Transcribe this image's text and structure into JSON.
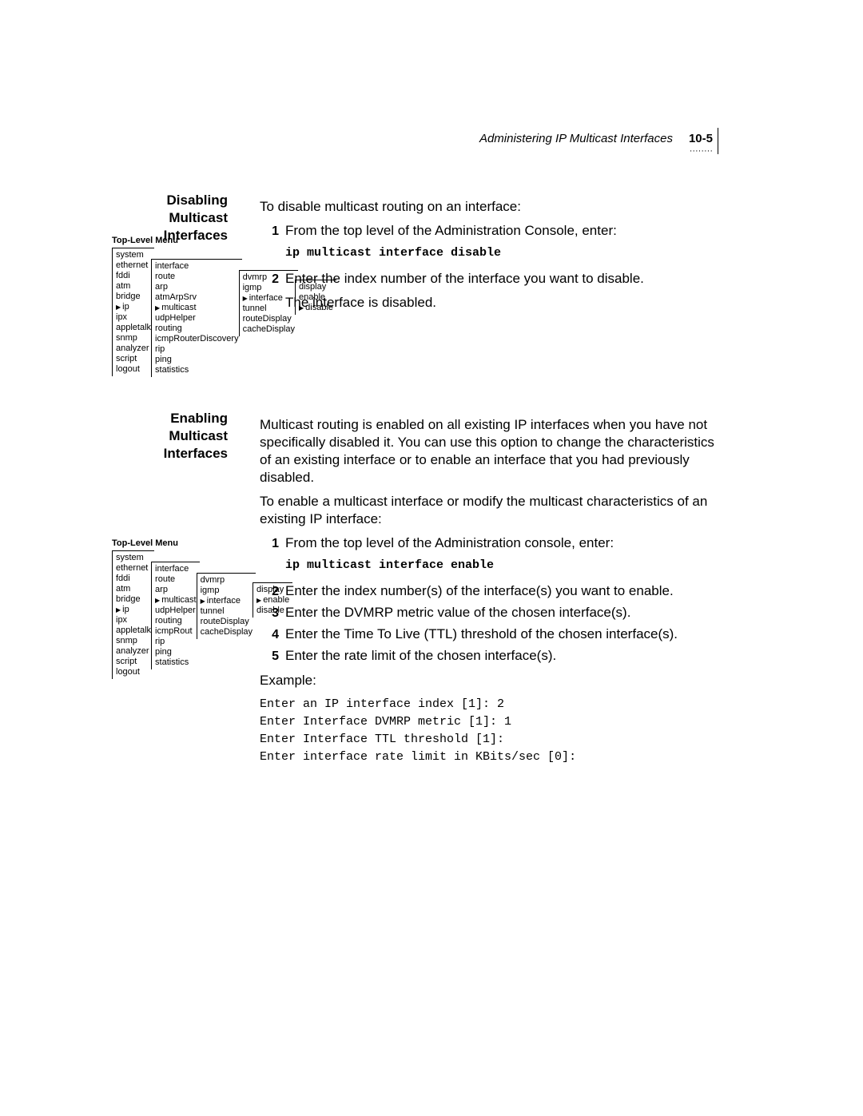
{
  "header": {
    "running": "Administering IP Multicast Interfaces",
    "page": "10-5",
    "dots": "········"
  },
  "disable": {
    "heading": "Disabling Multicast Interfaces",
    "intro": "To disable multicast routing on an interface:",
    "step1_lead": "From the top level of the Administration Console, enter:",
    "step1_code": "ip multicast interface disable",
    "step2": "Enter the index number of the interface you want to disable.",
    "result": "The interface is disabled."
  },
  "enable": {
    "heading": "Enabling Multicast Interfaces",
    "intro": "Multicast routing is enabled on all existing IP interfaces when you have not specifically disabled it. You can use this option to change the characteristics of an existing interface or to enable an interface that you had previously disabled.",
    "lead2": "To enable a multicast interface or modify the multicast characteristics of an existing IP interface:",
    "step1_lead": "From the top level of the Administration console, enter:",
    "step1_code": "ip multicast interface enable",
    "step2": "Enter the index number(s) of the interface(s) you want to enable.",
    "step3": "Enter the DVMRP metric value of the chosen interface(s).",
    "step4": "Enter the Time To Live (TTL) threshold of the chosen interface(s).",
    "step5": "Enter the rate limit of the chosen interface(s).",
    "example_label": "Example:",
    "example_code": "Enter an IP interface index [1]: 2\nEnter Interface DVMRP metric [1]: 1\nEnter Interface TTL threshold [1]:\nEnter interface rate limit in KBits/sec [0]:"
  },
  "menu": {
    "title": "Top-Level Menu",
    "col1": [
      "system",
      "ethernet",
      "fddi",
      "atm",
      "bridge",
      "ip",
      "ipx",
      "appletalk",
      "snmp",
      "analyzer",
      "script",
      "logout"
    ],
    "col2_disable": [
      "interface",
      "route",
      "arp",
      "atmArpSrv",
      "multicast",
      "udpHelper",
      "routing",
      "icmpRouterDiscovery",
      "rip",
      "ping",
      "statistics"
    ],
    "col2_enable": [
      "interface",
      "route",
      "arp",
      "multicast",
      "udpHelper",
      "routing",
      "icmpRout",
      "rip",
      "ping",
      "statistics"
    ],
    "col3": [
      "dvmrp",
      "igmp",
      "interface",
      "tunnel",
      "routeDisplay",
      "cacheDisplay"
    ],
    "col4": [
      "display",
      "enable",
      "disable"
    ]
  }
}
